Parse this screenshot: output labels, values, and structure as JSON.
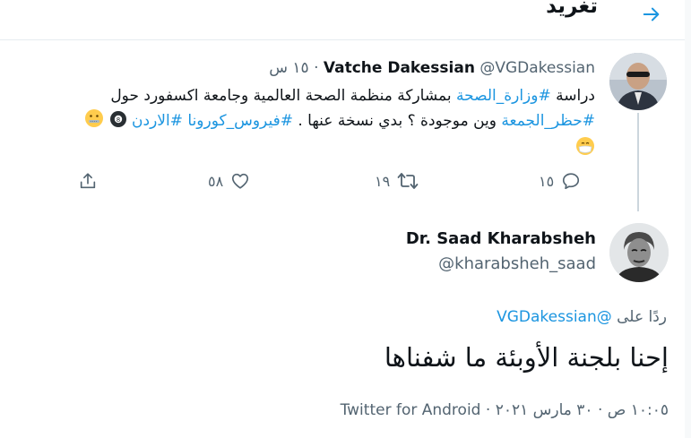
{
  "header": {
    "title": "تغريد"
  },
  "parent_tweet": {
    "author_name": "Vatche Dakessian",
    "author_handle": "@VGDakessian",
    "separator": "·",
    "time": "١٥ س",
    "text": {
      "w1": "دراسة ",
      "tag1": "#وزارة_الصحة",
      "w2": " بمشاركة منظمة الصحة العالمية وجامعة اكسفورد حول ",
      "tag2": "#حظر_الجمعة",
      "w3": " وين موجودة ؟ بدي نسخة عنها . ",
      "tag3": "#فيروس_كورونا",
      "w4": " ",
      "tag4": "#الاردن",
      "emojis": [
        "zipper-mouth-face",
        "8-ball",
        "mask-face"
      ]
    },
    "actions": {
      "replies": "١٥",
      "retweets": "١٩",
      "likes": "٥٨"
    }
  },
  "reply_tweet": {
    "author_name": "Dr. Saad Kharabsheh",
    "author_handle": "@kharabsheh_saad",
    "replying_to_label": "ردًا على",
    "replying_to_handle": "@VGDakessian",
    "text": "إحنا بلجنة الأوبئة ما شفناها",
    "time": "١٠:٠٥ ص",
    "date": "٣٠ مارس ٢٠٢١",
    "separator": "·",
    "source": "Twitter for Android"
  },
  "colors": {
    "accent": "#1b95e0",
    "text": "#0f1419",
    "muted": "#536471"
  }
}
